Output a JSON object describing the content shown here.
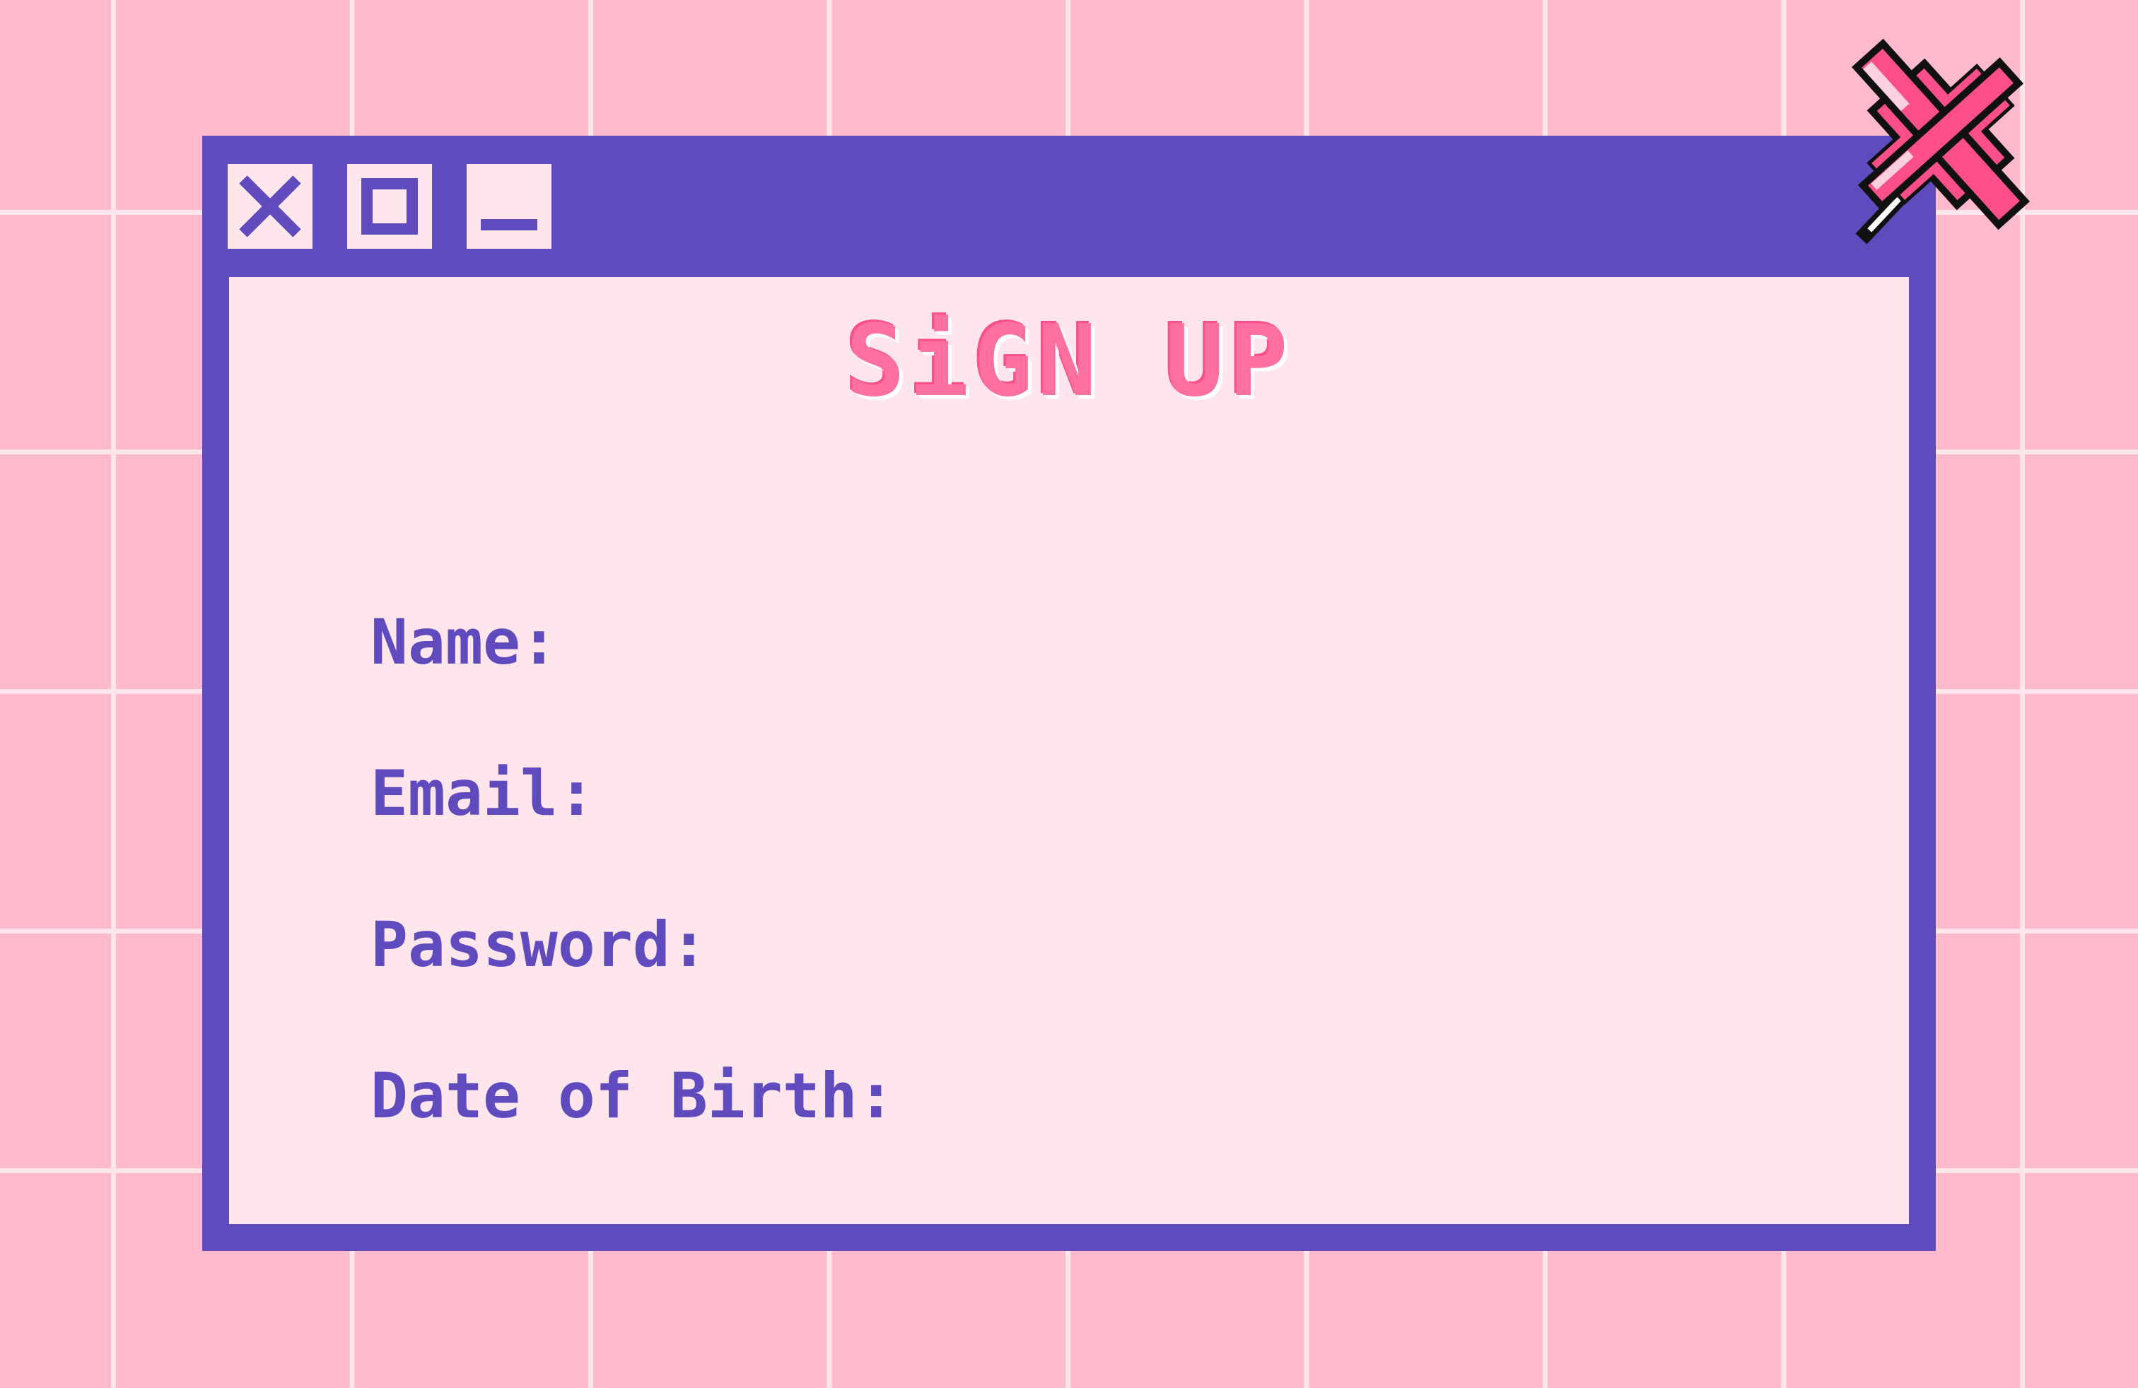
{
  "form": {
    "title": "SiGN UP",
    "fields": [
      {
        "label": "Name:",
        "value": ""
      },
      {
        "label": "Email:",
        "value": ""
      },
      {
        "label": "Password:",
        "value": ""
      },
      {
        "label": "Date of Birth:",
        "value": ""
      }
    ]
  },
  "window_controls": {
    "close_icon": "close-icon",
    "maximize_icon": "maximize-icon",
    "minimize_icon": "minimize-icon"
  },
  "decorations": {
    "pin_icon": "pushpin-icon"
  },
  "colors": {
    "background": "#ffbacd",
    "grid_lines": "#ffe6ec",
    "window_frame": "#5f4bbd",
    "content_background": "#ffe6ec",
    "title_text": "#ff6fa0",
    "label_text": "#5f4bbd",
    "pin": "#ff4f88"
  }
}
